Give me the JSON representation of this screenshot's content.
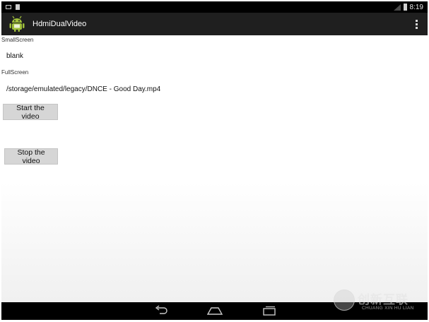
{
  "status_bar": {
    "time": "8:19"
  },
  "action_bar": {
    "app_title": "HdmiDualVideo",
    "logo_icon": "android-icon",
    "overflow_icon": "overflow-menu-icon"
  },
  "content": {
    "small_screen_label": "SmallScreen",
    "small_screen_value": "blank",
    "full_screen_label": "FullScreen",
    "full_screen_value": "/storage/emulated/legacy/DNCE - Good Day.mp4",
    "start_button_label": "Start the video",
    "stop_button_label": "Stop the video"
  },
  "nav_bar": {
    "back_icon": "back-icon",
    "home_icon": "home-icon",
    "recents_icon": "recents-icon"
  },
  "watermark": {
    "main_text": "创新互联",
    "sub_text": "CHUANG XIN HU LIAN"
  },
  "colors": {
    "status_bar_bg": "#000000",
    "action_bar_bg": "#1f1f1f",
    "android_green": "#9fbf3b",
    "button_bg": "#d6d6d6"
  }
}
